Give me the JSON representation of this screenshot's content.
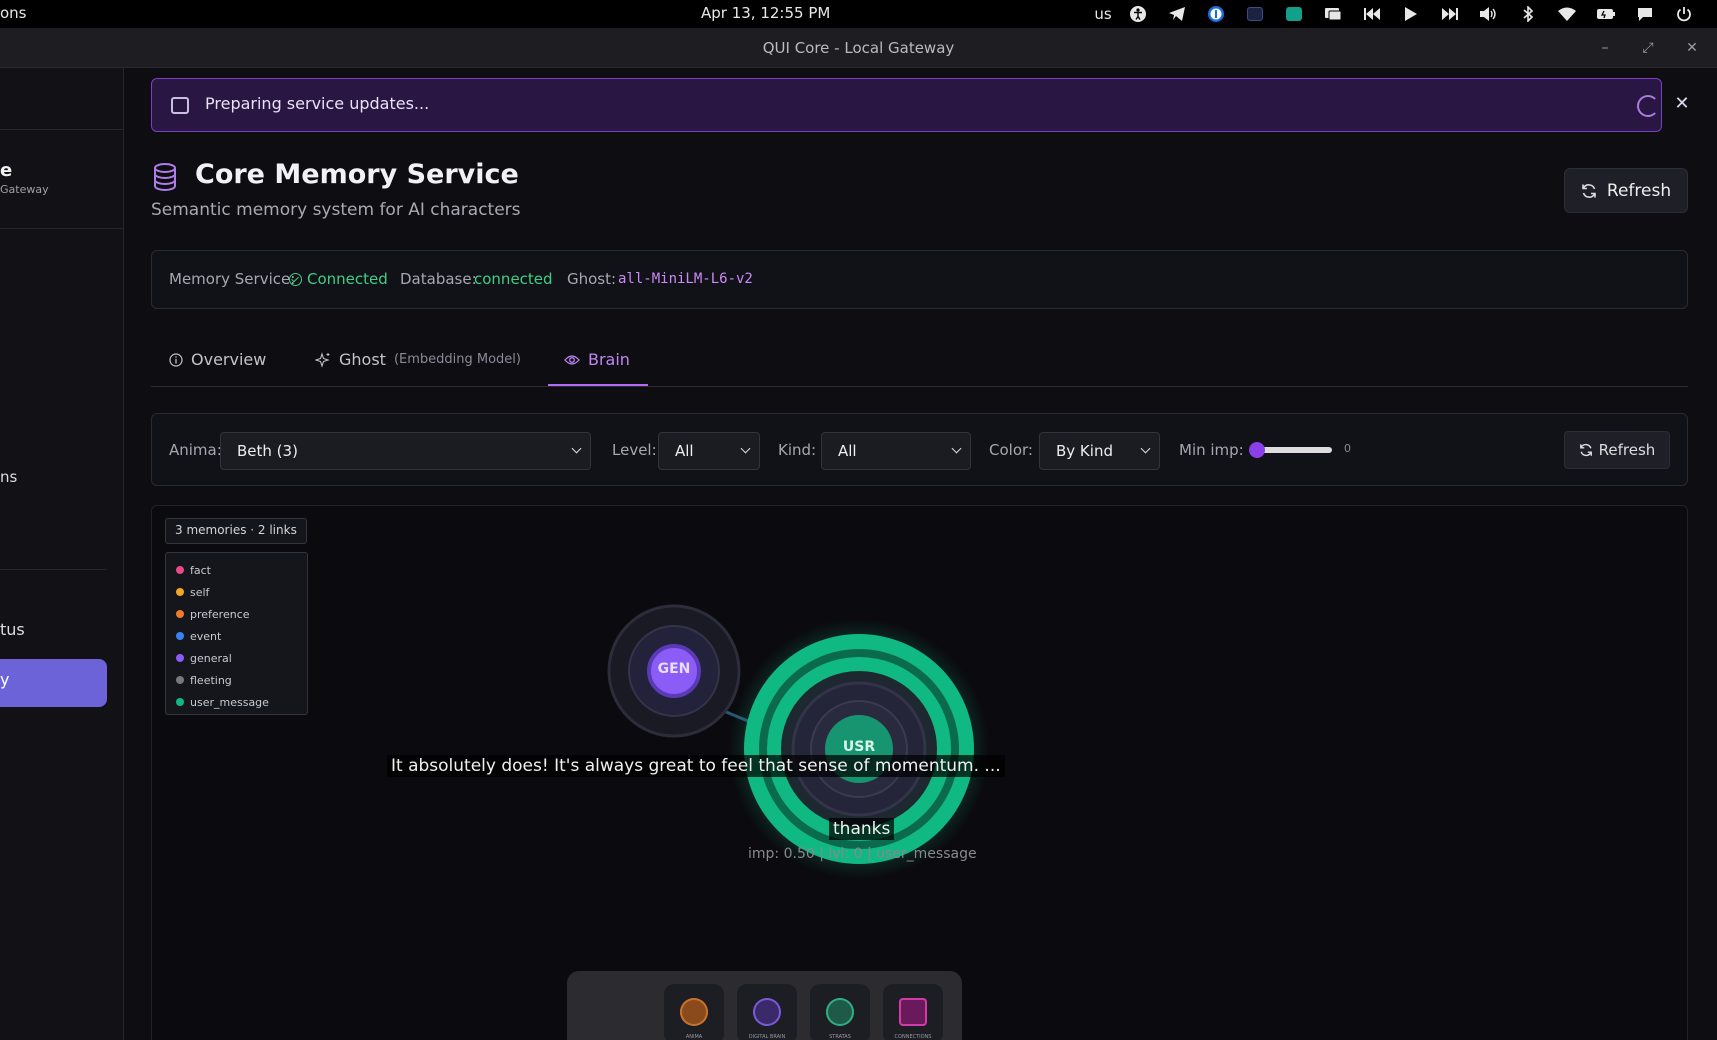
{
  "system_bar": {
    "left_fragment": "ons",
    "clock": "Apr 13, 12:55 PM",
    "keyboard_layout": "us",
    "tray_icons": [
      "accessibility-icon",
      "telegram-icon",
      "password-manager-icon",
      "app-indicator-icon",
      "chat-app-icon",
      "screen-share-icon",
      "previous-track-icon",
      "play-icon",
      "next-track-icon",
      "volume-icon",
      "bluetooth-icon",
      "wifi-icon",
      "battery-icon",
      "notifications-icon",
      "power-icon"
    ]
  },
  "window": {
    "title": "QUI Core - Local Gateway"
  },
  "sidebar": {
    "brand_fragment": "e",
    "brand_sub_fragment": "Gateway",
    "item_fragment_1": "ns",
    "item_fragment_2": "tus",
    "active_item_fragment": "y"
  },
  "banner": {
    "text": "Preparing service updates..."
  },
  "header": {
    "title": "Core Memory Service",
    "subtitle": "Semantic memory system for AI characters",
    "refresh_label": "Refresh"
  },
  "status": {
    "memory_label": "Memory Service:",
    "memory_value": "Connected",
    "db_label": "Database:",
    "db_value": "connected",
    "ghost_label": "Ghost:",
    "ghost_value": "all-MiniLM-L6-v2",
    "colors": {
      "ok": "#3fcf82",
      "model": "#c98bf5"
    }
  },
  "tabs": [
    {
      "label": "Overview",
      "sub": "",
      "icon": "info-icon"
    },
    {
      "label": "Ghost",
      "sub": "(Embedding Model)",
      "icon": "sparkles-icon"
    },
    {
      "label": "Brain",
      "sub": "",
      "icon": "eye-icon",
      "active": true
    }
  ],
  "filters": {
    "anima_label": "Anima:",
    "anima_value": "Beth (3)",
    "level_label": "Level:",
    "level_value": "All",
    "kind_label": "Kind:",
    "kind_value": "All",
    "color_label": "Color:",
    "color_value": "By Kind",
    "min_imp_label": "Min imp:",
    "min_imp_value": "0",
    "refresh_label": "Refresh"
  },
  "graph": {
    "summary": "3 memories · 2 links",
    "legend": [
      {
        "label": "fact",
        "color": "#e84a8a"
      },
      {
        "label": "self",
        "color": "#f5a623"
      },
      {
        "label": "preference",
        "color": "#f07a2a"
      },
      {
        "label": "event",
        "color": "#3b82f6"
      },
      {
        "label": "general",
        "color": "#8b5cf6"
      },
      {
        "label": "fleeting",
        "color": "#777780"
      },
      {
        "label": "user_message",
        "color": "#10b981"
      }
    ],
    "nodes": [
      {
        "label": "GEN",
        "kind": "general"
      },
      {
        "label": "USR",
        "kind": "user_message"
      }
    ],
    "caption_long": "It absolutely does! It's always great to feel that sense of momentum. ...",
    "caption_short": "thanks",
    "selected_meta": "imp: 0.50 | lvl: 0 | user_message"
  },
  "dock": {
    "apps": [
      {
        "label": "ANIMA",
        "icon": "anima-app-icon",
        "color": "#8a4a1c"
      },
      {
        "label": "DIGITAL BRAIN",
        "icon": "digital-brain-app-icon",
        "color": "#5b3aa8"
      },
      {
        "label": "STRATAS",
        "icon": "stratas-app-icon",
        "color": "#1f7a5c"
      },
      {
        "label": "CONNECTIONS",
        "icon": "connections-app-icon",
        "color": "#a3288a"
      }
    ]
  }
}
